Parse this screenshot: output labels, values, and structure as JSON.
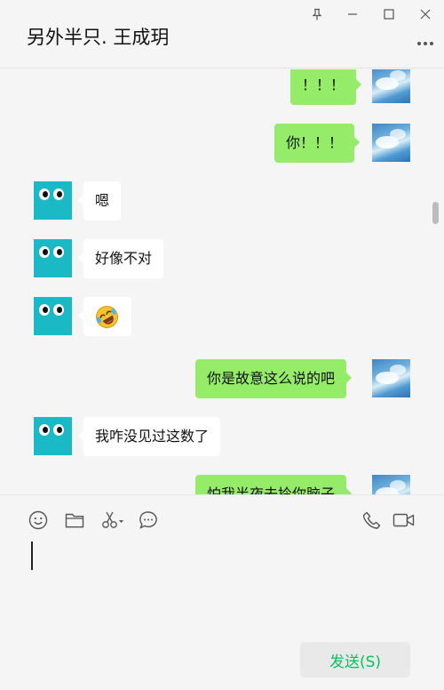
{
  "header": {
    "title": "另外半只. 王成玥"
  },
  "window_controls": {
    "icons": [
      "pin-icon",
      "minimize-icon",
      "maximize-icon",
      "close-icon"
    ]
  },
  "messages": [
    {
      "side": "self",
      "text": "！！！"
    },
    {
      "side": "self",
      "text": "你！！！"
    },
    {
      "side": "other",
      "text": "嗯"
    },
    {
      "side": "other",
      "text": "好像不对"
    },
    {
      "side": "other",
      "text": "",
      "emoji": "rolling-laughing-emoji"
    },
    {
      "side": "self",
      "text": "你是故意这么说的吧"
    },
    {
      "side": "other",
      "text": "我咋没见过这数了"
    },
    {
      "side": "self",
      "text": "怕我半夜去拎你脑子"
    }
  ],
  "toolbar": {
    "icons": [
      "emoji-icon",
      "folder-icon",
      "scissors-icon",
      "chat-bubble-icon",
      "phone-icon",
      "video-icon"
    ]
  },
  "input": {
    "value": ""
  },
  "send_button": {
    "label": "发送(S)"
  },
  "colors": {
    "background": "#f5f5f5",
    "self_bubble": "#95ec69",
    "other_bubble": "#ffffff",
    "send_text": "#07c160",
    "other_avatar": "#1ab9c5"
  }
}
